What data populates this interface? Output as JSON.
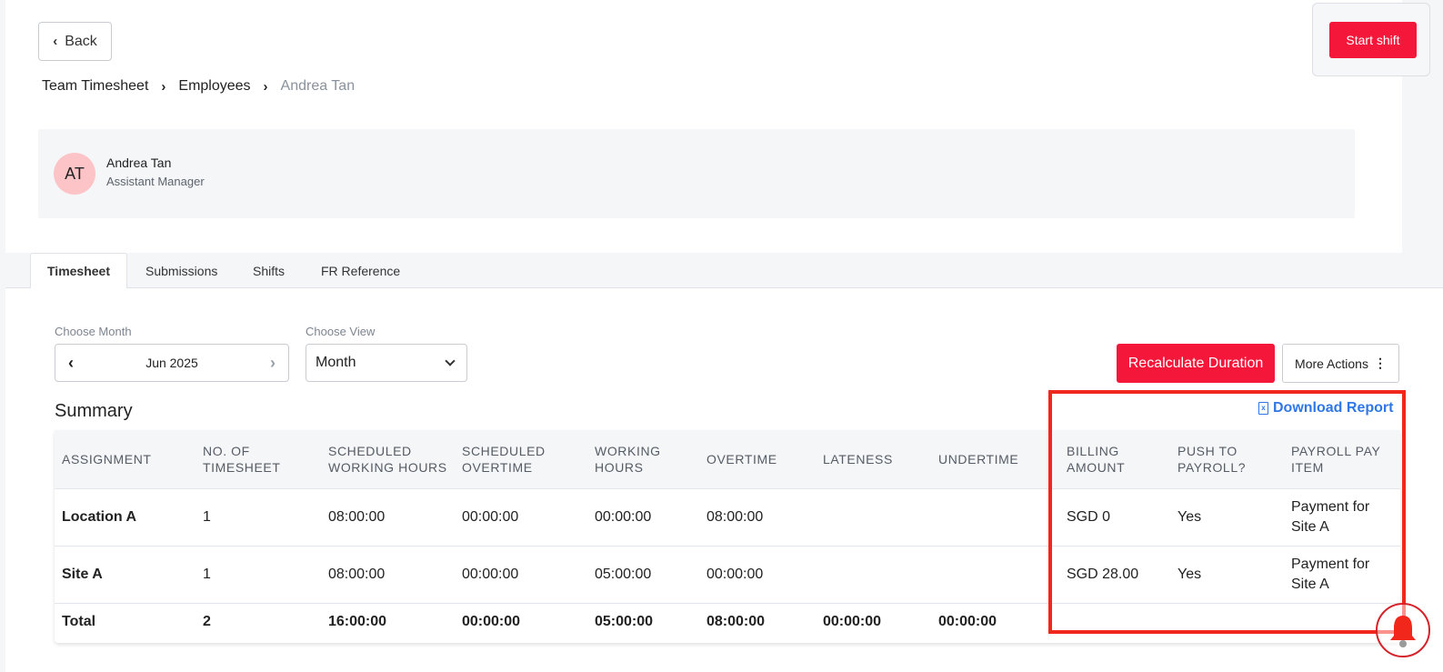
{
  "back": {
    "label": "Back"
  },
  "breadcrumb": [
    {
      "label": "Team Timesheet"
    },
    {
      "label": "Employees"
    },
    {
      "label": "Andrea Tan"
    }
  ],
  "header": {
    "start_shift_label": "Start shift"
  },
  "profile": {
    "initials": "AT",
    "name": "Andrea Tan",
    "role": "Assistant Manager"
  },
  "tabs": [
    {
      "label": "Timesheet",
      "active": true
    },
    {
      "label": "Submissions"
    },
    {
      "label": "Shifts"
    },
    {
      "label": "FR Reference"
    }
  ],
  "filters": {
    "month_label": "Choose Month",
    "month_value": "Jun 2025",
    "view_label": "Choose View",
    "view_value": "Month"
  },
  "actions": {
    "recalculate_label": "Recalculate Duration",
    "more_label": "More Actions"
  },
  "summary": {
    "title": "Summary",
    "download_label": "Download Report",
    "columns": [
      [
        "ASSIGNMENT",
        ""
      ],
      [
        "NO. OF",
        "TIMESHEET"
      ],
      [
        "SCHEDULED",
        "WORKING HOURS"
      ],
      [
        "SCHEDULED",
        "OVERTIME"
      ],
      [
        "WORKING",
        "HOURS"
      ],
      [
        "OVERTIME",
        ""
      ],
      [
        "LATENESS",
        ""
      ],
      [
        "UNDERTIME",
        ""
      ],
      [
        "BILLING",
        "AMOUNT"
      ],
      [
        "PUSH TO",
        "PAYROLL?"
      ],
      [
        "PAYROLL PAY",
        "ITEM"
      ]
    ],
    "rows": [
      {
        "assignment": "Location A",
        "timesheets": "1",
        "sched_hours": "08:00:00",
        "sched_ot": "00:00:00",
        "working": "00:00:00",
        "overtime": "08:00:00",
        "lateness": "",
        "undertime": "",
        "billing": "SGD 0",
        "push": "Yes",
        "pay_item_1": "Payment for",
        "pay_item_2": "Site A"
      },
      {
        "assignment": "Site A",
        "timesheets": "1",
        "sched_hours": "08:00:00",
        "sched_ot": "00:00:00",
        "working": "05:00:00",
        "overtime": "00:00:00",
        "lateness": "",
        "undertime": "",
        "billing": "SGD 28.00",
        "push": "Yes",
        "pay_item_1": "Payment for",
        "pay_item_2": "Site A"
      }
    ],
    "total": {
      "label": "Total",
      "timesheets": "2",
      "sched_hours": "16:00:00",
      "sched_ot": "00:00:00",
      "working": "05:00:00",
      "overtime": "08:00:00",
      "lateness": "00:00:00",
      "undertime": "00:00:00"
    }
  },
  "icons": {
    "back": "chevron-left-icon",
    "breadcrumb_sep": "chevron-right-icon",
    "prev_month": "chevron-left-icon",
    "next_month": "chevron-right-icon",
    "view_caret": "chevron-down-icon",
    "more": "vertical-dots-icon",
    "download": "excel-file-icon",
    "fab": "bell-icon"
  },
  "colors": {
    "primary": "#f5173a",
    "link": "#2f77e8",
    "highlight": "#f0271a",
    "avatar_bg": "#fdc4c8"
  }
}
